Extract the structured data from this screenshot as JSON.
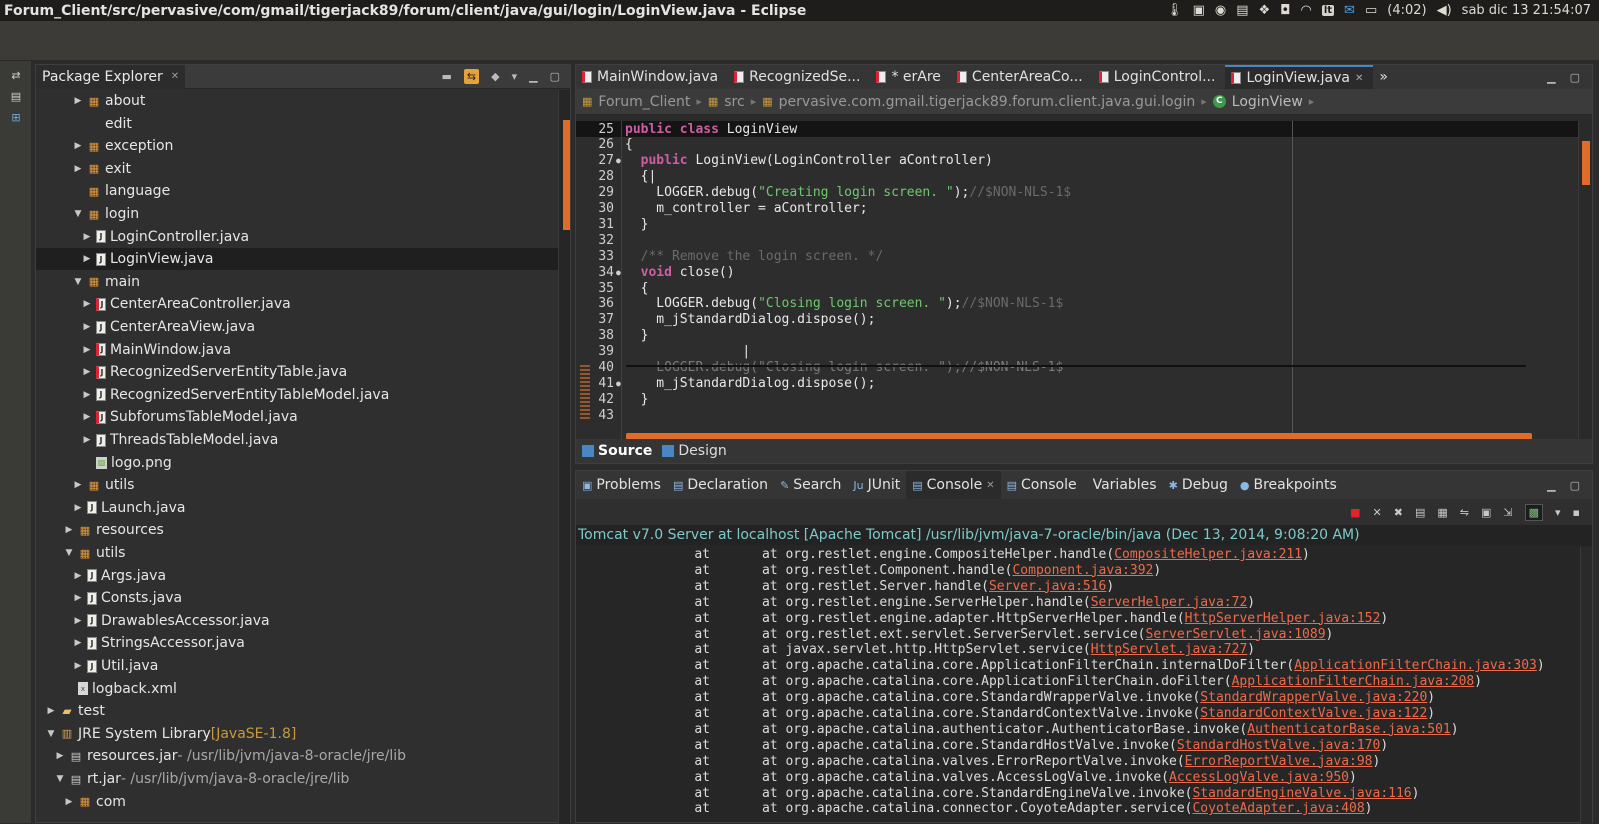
{
  "window": {
    "title": "Forum_Client/src/pervasive/com/gmail/tigerjack89/forum/client/java/gui/login/LoginView.java - Eclipse",
    "battery": "(4:02)",
    "clock": "sab dic 13 21:54:07",
    "tray_badge": "lt"
  },
  "explorer": {
    "tab_label": "Package Explorer",
    "items": [
      {
        "label": "about",
        "decor": "",
        "icon": "pkg",
        "arrow": "▸",
        "indent": 36,
        "sel": false
      },
      {
        "label": "edit",
        "decor": "",
        "icon": "",
        "arrow": "",
        "indent": 36,
        "sel": false
      },
      {
        "label": "exception",
        "decor": "",
        "icon": "pkg",
        "arrow": "▸",
        "indent": 36,
        "sel": false
      },
      {
        "label": "exit",
        "decor": "",
        "icon": "pkg",
        "arrow": "▸",
        "indent": 36,
        "sel": false
      },
      {
        "label": "language",
        "decor": "",
        "icon": "pkg",
        "arrow": "",
        "indent": 36,
        "sel": false
      },
      {
        "label": "login",
        "decor": "",
        "icon": "pkg",
        "arrow": "▾",
        "indent": 36,
        "sel": false
      },
      {
        "label": "LoginController.java",
        "decor": "",
        "icon": "java",
        "arrow": "▸",
        "indent": 45,
        "sel": false
      },
      {
        "label": "LoginView.java",
        "decor": "",
        "icon": "java",
        "arrow": "▸",
        "indent": 45,
        "sel": true
      },
      {
        "label": "main",
        "decor": "",
        "icon": "pkg",
        "arrow": "▾",
        "indent": 36,
        "sel": false
      },
      {
        "label": "CenterAreaController.java",
        "decor": "",
        "icon": "javar",
        "arrow": "▸",
        "indent": 45,
        "sel": false
      },
      {
        "label": "CenterAreaView.java",
        "decor": "",
        "icon": "java",
        "arrow": "▸",
        "indent": 45,
        "sel": false
      },
      {
        "label": "MainWindow.java",
        "decor": "",
        "icon": "javar",
        "arrow": "▸",
        "indent": 45,
        "sel": false
      },
      {
        "label": "RecognizedServerEntityTable.java",
        "decor": "",
        "icon": "javar",
        "arrow": "▸",
        "indent": 45,
        "sel": false
      },
      {
        "label": "RecognizedServerEntityTableModel.java",
        "decor": "",
        "icon": "java",
        "arrow": "▸",
        "indent": 45,
        "sel": false
      },
      {
        "label": "SubforumsTableModel.java",
        "decor": "",
        "icon": "javar",
        "arrow": "▸",
        "indent": 45,
        "sel": false
      },
      {
        "label": "ThreadsTableModel.java",
        "decor": "",
        "icon": "java",
        "arrow": "▸",
        "indent": 45,
        "sel": false
      },
      {
        "label": "logo.png",
        "decor": "",
        "icon": "png",
        "arrow": "",
        "indent": 45,
        "sel": false
      },
      {
        "label": "utils",
        "decor": "",
        "icon": "pkg",
        "arrow": "▸",
        "indent": 36,
        "sel": false
      },
      {
        "label": "Launch.java",
        "decor": "",
        "icon": "java",
        "arrow": "▸",
        "indent": 36,
        "sel": false
      },
      {
        "label": "resources",
        "decor": "",
        "icon": "pkg",
        "arrow": "▸",
        "indent": 27,
        "sel": false
      },
      {
        "label": "utils",
        "decor": "",
        "icon": "pkg",
        "arrow": "▾",
        "indent": 27,
        "sel": false
      },
      {
        "label": "Args.java",
        "decor": "",
        "icon": "java",
        "arrow": "▸",
        "indent": 36,
        "sel": false
      },
      {
        "label": "Consts.java",
        "decor": "",
        "icon": "java",
        "arrow": "▸",
        "indent": 36,
        "sel": false
      },
      {
        "label": "DrawablesAccessor.java",
        "decor": "",
        "icon": "java",
        "arrow": "▸",
        "indent": 36,
        "sel": false
      },
      {
        "label": "StringsAccessor.java",
        "decor": "",
        "icon": "java",
        "arrow": "▸",
        "indent": 36,
        "sel": false
      },
      {
        "label": "Util.java",
        "decor": "",
        "icon": "java",
        "arrow": "▸",
        "indent": 36,
        "sel": false
      },
      {
        "label": "logback.xml",
        "decor": "",
        "icon": "xml",
        "arrow": "",
        "indent": 27,
        "sel": false
      },
      {
        "label": "test",
        "decor": "",
        "icon": "folder",
        "arrow": "▸",
        "indent": 9,
        "sel": false
      },
      {
        "label": "JRE System Library",
        "decor": " [JavaSE-1.8]",
        "icon": "lib",
        "arrow": "▾",
        "indent": 9,
        "sel": false
      },
      {
        "label": "resources.jar",
        "decor": " - /usr/lib/jvm/java-8-oracle/jre/lib",
        "icon": "jar",
        "arrow": "▸",
        "indent": 18,
        "sel": false
      },
      {
        "label": "rt.jar",
        "decor": " - /usr/lib/jvm/java-8-oracle/jre/lib",
        "icon": "jar",
        "arrow": "▾",
        "indent": 18,
        "sel": false
      },
      {
        "label": "com",
        "decor": "",
        "icon": "pkg",
        "arrow": "▸",
        "indent": 27,
        "sel": false
      }
    ]
  },
  "editor": {
    "tabs": [
      {
        "label": "MainWindow.java",
        "active": false
      },
      {
        "label": "RecognizedSe...",
        "active": false
      },
      {
        "label": "* erAre",
        "active": false
      },
      {
        "label": "CenterAreaCo...",
        "active": false
      },
      {
        "label": "LoginControl...",
        "active": false
      },
      {
        "label": "LoginView.java",
        "active": true
      }
    ],
    "breadcrumb": [
      "Forum_Client",
      "src",
      "pervasive.com.gmail.tigerjack89.forum.client.java.gui.login",
      "LoginView"
    ],
    "lines": [
      {
        "n": "25",
        "fold": "",
        "cur": true,
        "ghost": false,
        "parts": [
          {
            "t": "kw",
            "v": "public class"
          },
          {
            "t": "",
            "v": " LoginView"
          }
        ]
      },
      {
        "n": "26",
        "fold": "",
        "cur": false,
        "ghost": false,
        "parts": [
          {
            "t": "",
            "v": "{"
          }
        ]
      },
      {
        "n": "27",
        "fold": "●",
        "cur": false,
        "ghost": false,
        "parts": [
          {
            "t": "",
            "v": "  "
          },
          {
            "t": "kw",
            "v": "public"
          },
          {
            "t": "",
            "v": " LoginView(LoginController aController)"
          }
        ]
      },
      {
        "n": "28",
        "fold": "",
        "cur": false,
        "ghost": false,
        "parts": [
          {
            "t": "",
            "v": "  {|"
          }
        ]
      },
      {
        "n": "29",
        "fold": "",
        "cur": false,
        "ghost": false,
        "parts": [
          {
            "t": "",
            "v": "    LOGGER.debug("
          },
          {
            "t": "str",
            "v": "\"Creating login screen. \""
          },
          {
            "t": "",
            "v": ");"
          },
          {
            "t": "cm",
            "v": "//$NON-NLS-1$"
          }
        ]
      },
      {
        "n": "30",
        "fold": "",
        "cur": false,
        "ghost": false,
        "parts": [
          {
            "t": "",
            "v": "    m_controller = aController;"
          }
        ]
      },
      {
        "n": "31",
        "fold": "",
        "cur": false,
        "ghost": false,
        "parts": [
          {
            "t": "",
            "v": "  }"
          }
        ]
      },
      {
        "n": "32",
        "fold": "",
        "cur": false,
        "ghost": false,
        "parts": [
          {
            "t": "",
            "v": ""
          }
        ]
      },
      {
        "n": "33",
        "fold": "",
        "cur": false,
        "ghost": false,
        "parts": [
          {
            "t": "cm",
            "v": "  /** Remove the login screen. */"
          }
        ]
      },
      {
        "n": "34",
        "fold": "●",
        "cur": false,
        "ghost": false,
        "parts": [
          {
            "t": "",
            "v": "  "
          },
          {
            "t": "kw",
            "v": "void"
          },
          {
            "t": "",
            "v": " close()"
          }
        ]
      },
      {
        "n": "35",
        "fold": "",
        "cur": false,
        "ghost": false,
        "parts": [
          {
            "t": "",
            "v": "  {"
          }
        ]
      },
      {
        "n": "36",
        "fold": "",
        "cur": false,
        "ghost": false,
        "parts": [
          {
            "t": "",
            "v": "    LOGGER.debug("
          },
          {
            "t": "str",
            "v": "\"Closing login screen. \""
          },
          {
            "t": "",
            "v": ");"
          },
          {
            "t": "cm",
            "v": "//$NON-NLS-1$"
          }
        ]
      },
      {
        "n": "37",
        "fold": "",
        "cur": false,
        "ghost": false,
        "parts": [
          {
            "t": "",
            "v": "    m_jStandardDialog.dispose();"
          }
        ]
      },
      {
        "n": "38",
        "fold": "",
        "cur": false,
        "ghost": false,
        "parts": [
          {
            "t": "",
            "v": "  }"
          }
        ]
      },
      {
        "n": "39",
        "fold": "",
        "cur": false,
        "ghost": false,
        "parts": [
          {
            "t": "",
            "v": "               |"
          }
        ]
      },
      {
        "n": "40",
        "fold": "",
        "cur": false,
        "ghost": true,
        "parts": [
          {
            "t": "",
            "v": "    LOGGER.debug(\"Closing login screen. \");//$NON-NLS-1$"
          }
        ]
      },
      {
        "n": "41",
        "fold": "●",
        "cur": false,
        "ghost": false,
        "parts": [
          {
            "t": "",
            "v": "    m_jStandardDialog.dispose();"
          }
        ]
      },
      {
        "n": "42",
        "fold": "",
        "cur": false,
        "ghost": false,
        "parts": [
          {
            "t": "",
            "v": "  }"
          }
        ]
      },
      {
        "n": "43",
        "fold": "",
        "cur": false,
        "ghost": false,
        "parts": [
          {
            "t": "",
            "v": ""
          }
        ]
      }
    ],
    "bottom_tabs": [
      {
        "label": "Source",
        "active": true
      },
      {
        "label": "Design",
        "active": false
      }
    ]
  },
  "console": {
    "tabs": [
      {
        "label": "Problems",
        "active": false,
        "closable": false
      },
      {
        "label": "Declaration",
        "active": false,
        "closable": false
      },
      {
        "label": "Search",
        "active": false,
        "closable": false
      },
      {
        "label": "JUnit",
        "active": false,
        "closable": false
      },
      {
        "label": "Console",
        "active": true,
        "closable": true
      },
      {
        "label": "Console",
        "active": false,
        "closable": false
      },
      {
        "label": "Variables",
        "active": false,
        "closable": false
      },
      {
        "label": "Debug",
        "active": false,
        "closable": false
      },
      {
        "label": "Breakpoints",
        "active": false,
        "closable": false
      }
    ],
    "header": "Tomcat v7.0 Server at localhost [Apache Tomcat] /usr/lib/jvm/java-7-oracle/bin/java (Dec 13, 2014, 9:08:20 AM)",
    "rows": [
      {
        "call": "org.restlet.engine.CompositeHelper.handle(",
        "link": "CompositeHelper.java:211"
      },
      {
        "call": "org.restlet.Component.handle(",
        "link": "Component.java:392"
      },
      {
        "call": "org.restlet.Server.handle(",
        "link": "Server.java:516"
      },
      {
        "call": "org.restlet.engine.ServerHelper.handle(",
        "link": "ServerHelper.java:72"
      },
      {
        "call": "org.restlet.engine.adapter.HttpServerHelper.handle(",
        "link": "HttpServerHelper.java:152"
      },
      {
        "call": "org.restlet.ext.servlet.ServerServlet.service(",
        "link": "ServerServlet.java:1089"
      },
      {
        "call": "javax.servlet.http.HttpServlet.service(",
        "link": "HttpServlet.java:727"
      },
      {
        "call": "org.apache.catalina.core.ApplicationFilterChain.internalDoFilter(",
        "link": "ApplicationFilterChain.java:303"
      },
      {
        "call": "org.apache.catalina.core.ApplicationFilterChain.doFilter(",
        "link": "ApplicationFilterChain.java:208"
      },
      {
        "call": "org.apache.catalina.core.StandardWrapperValve.invoke(",
        "link": "StandardWrapperValve.java:220"
      },
      {
        "call": "org.apache.catalina.core.StandardContextValve.invoke(",
        "link": "StandardContextValve.java:122"
      },
      {
        "call": "org.apache.catalina.authenticator.AuthenticatorBase.invoke(",
        "link": "AuthenticatorBase.java:501"
      },
      {
        "call": "org.apache.catalina.core.StandardHostValve.invoke(",
        "link": "StandardHostValve.java:170"
      },
      {
        "call": "org.apache.catalina.valves.ErrorReportValve.invoke(",
        "link": "ErrorReportValve.java:98"
      },
      {
        "call": "org.apache.catalina.valves.AccessLogValve.invoke(",
        "link": "AccessLogValve.java:950"
      },
      {
        "call": "org.apache.catalina.core.StandardEngineValve.invoke(",
        "link": "StandardEngineValve.java:116"
      },
      {
        "call": "org.apache.catalina.connector.CoyoteAdapter.service(",
        "link": "CoyoteAdapter.java:408"
      }
    ],
    "at_word": "at"
  },
  "colors": {
    "accent": "#e06c2a",
    "keyword": "#cd5ea4",
    "string": "#6ec96e",
    "link": "#ef6a4a",
    "console_header": "#7fc9c9"
  }
}
